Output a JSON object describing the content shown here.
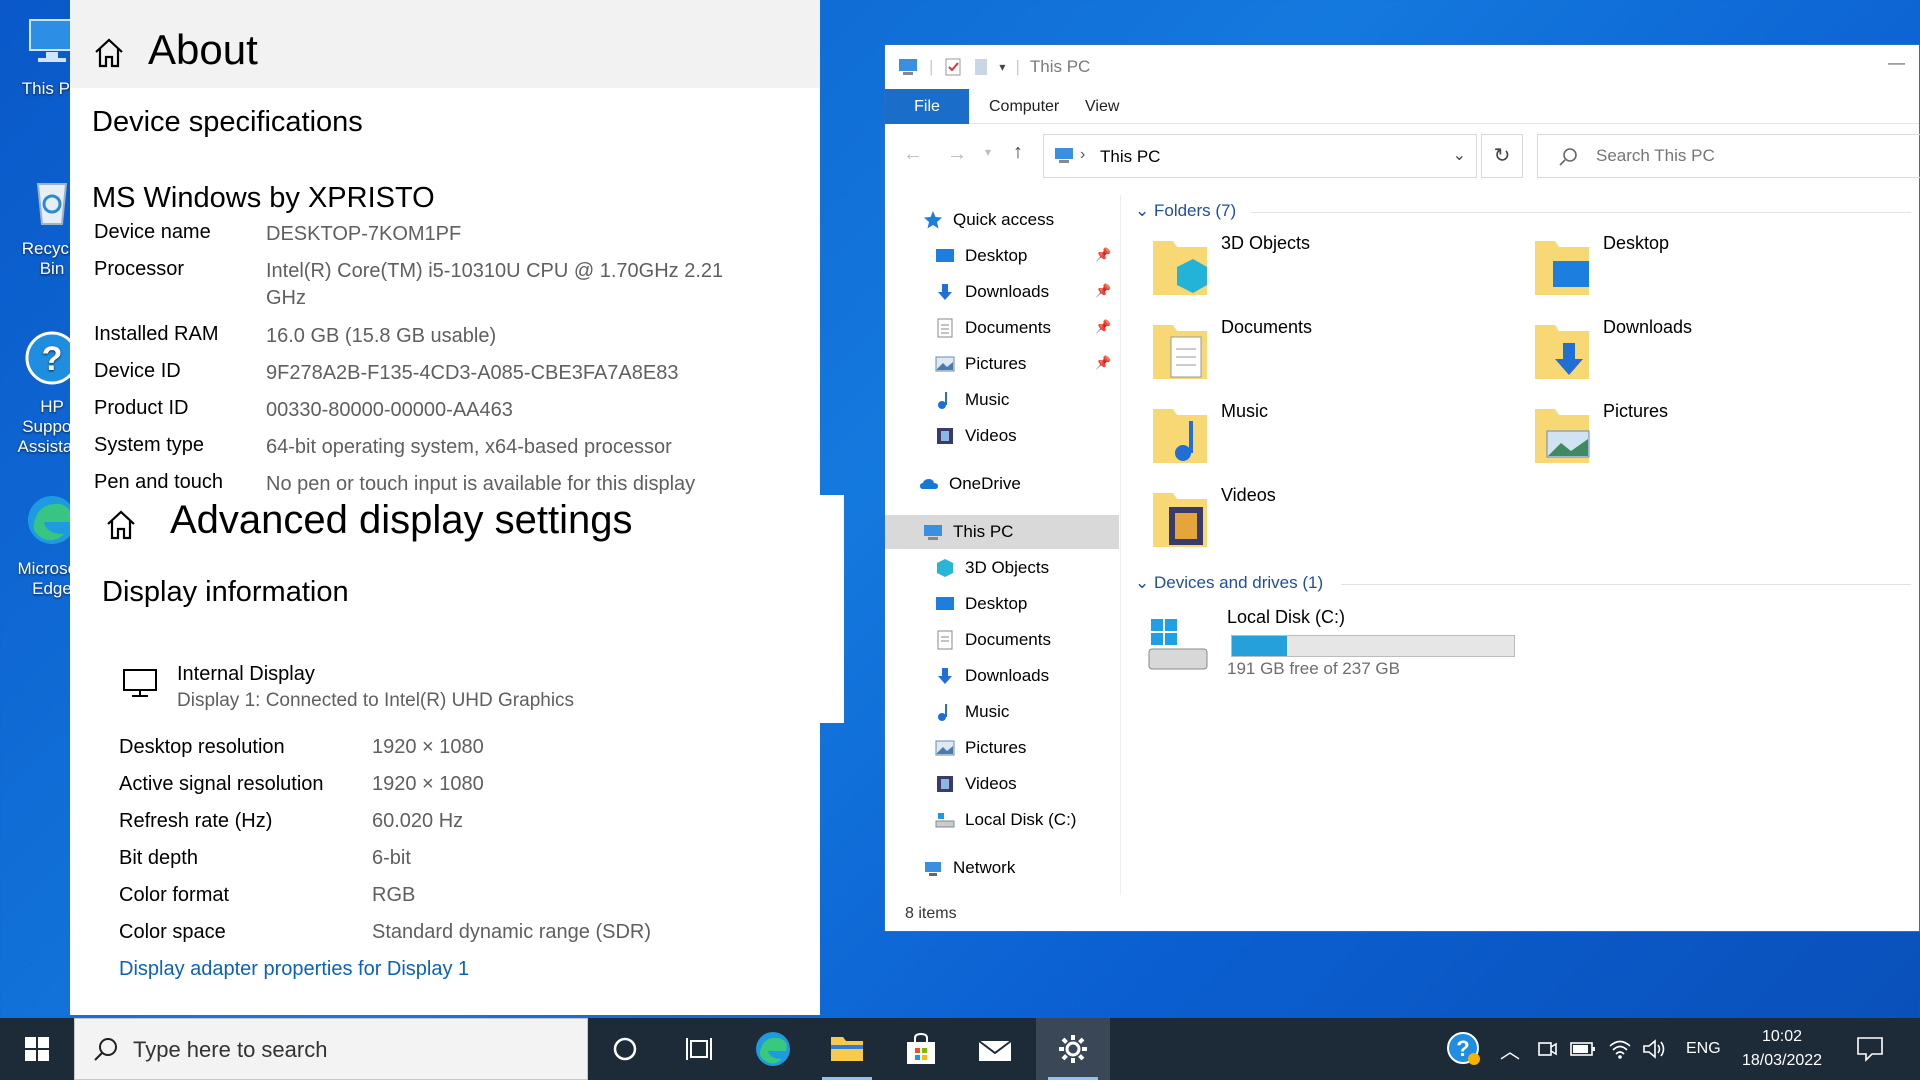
{
  "desktop": {
    "icons": [
      {
        "label": "This PC"
      },
      {
        "label": "Recycle Bin"
      },
      {
        "label": "HP Support Assistant"
      },
      {
        "label": "Microsoft Edge"
      }
    ]
  },
  "settings": {
    "about_title": "About",
    "device_specs_heading": "Device specifications",
    "edition": "MS Windows by XPRISTO",
    "specs": [
      {
        "key": "Device name",
        "value": "DESKTOP-7KOM1PF"
      },
      {
        "key": "Processor",
        "value": "Intel(R) Core(TM) i5-10310U CPU @ 1.70GHz   2.21 GHz"
      },
      {
        "key": "Installed RAM",
        "value": "16.0 GB (15.8 GB usable)"
      },
      {
        "key": "Device ID",
        "value": "9F278A2B-F135-4CD3-A085-CBE3FA7A8E83"
      },
      {
        "key": "Product ID",
        "value": "00330-80000-00000-AA463"
      },
      {
        "key": "System type",
        "value": "64-bit operating system, x64-based processor"
      },
      {
        "key": "Pen and touch",
        "value": "No pen or touch input is available for this display"
      }
    ],
    "advanced_title": "Advanced display settings",
    "display_info_heading": "Display information",
    "display_name": "Internal Display",
    "display_desc": "Display 1: Connected to Intel(R) UHD Graphics",
    "display_rows": [
      {
        "key": "Desktop resolution",
        "value": "1920 × 1080"
      },
      {
        "key": "Active signal resolution",
        "value": "1920 × 1080"
      },
      {
        "key": "Refresh rate (Hz)",
        "value": "60.020 Hz"
      },
      {
        "key": "Bit depth",
        "value": "6-bit"
      },
      {
        "key": "Color format",
        "value": "RGB"
      },
      {
        "key": "Color space",
        "value": "Standard dynamic range (SDR)"
      }
    ],
    "adapter_link": "Display adapter properties for Display 1"
  },
  "explorer": {
    "title": "This PC",
    "tabs": {
      "file": "File",
      "computer": "Computer",
      "view": "View"
    },
    "address": "This PC",
    "search_placeholder": "Search This PC",
    "nav": {
      "quick_access": "Quick access",
      "qa_items": [
        "Desktop",
        "Downloads",
        "Documents",
        "Pictures",
        "Music",
        "Videos"
      ],
      "onedrive": "OneDrive",
      "this_pc": "This PC",
      "pc_items": [
        "3D Objects",
        "Desktop",
        "Documents",
        "Downloads",
        "Music",
        "Pictures",
        "Videos",
        "Local Disk (C:)"
      ],
      "network": "Network"
    },
    "folders_heading": "Folders (7)",
    "folders": [
      "3D Objects",
      "Desktop",
      "Documents",
      "Downloads",
      "Music",
      "Pictures",
      "Videos"
    ],
    "drives_heading": "Devices and drives (1)",
    "drive": {
      "name": "Local Disk (C:)",
      "free_text": "191 GB free of 237 GB",
      "used_fraction": 0.194
    },
    "status": "8 items"
  },
  "taskbar": {
    "search_placeholder": "Type here to search",
    "language": "ENG",
    "time": "10:02",
    "date": "18/03/2022"
  }
}
